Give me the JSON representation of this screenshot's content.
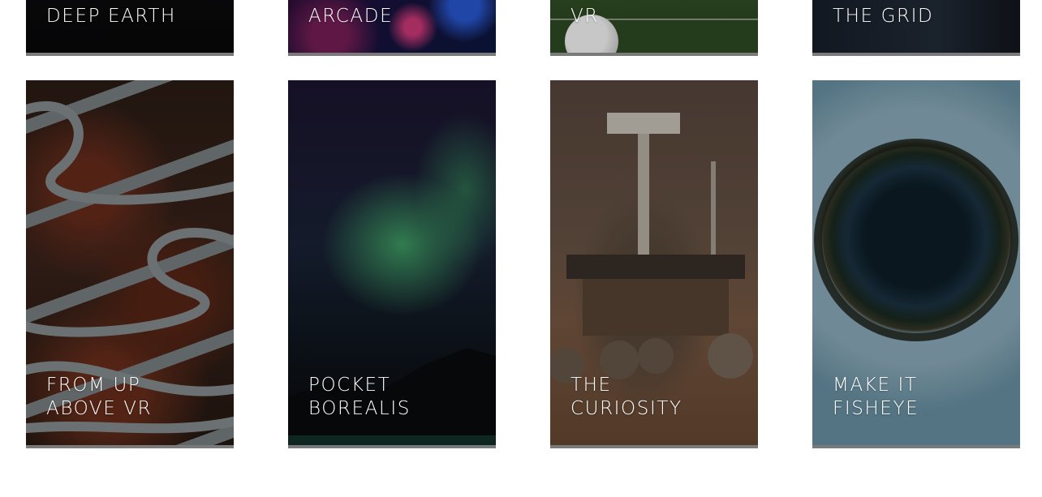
{
  "cards_row1": [
    {
      "title": "DEEP EARTH"
    },
    {
      "title": "NIGHT\nARCADE"
    },
    {
      "title": "SOCCER TEAM\nVR"
    },
    {
      "title": "THE GRID"
    }
  ],
  "cards_row2": [
    {
      "title": "FROM UP\nABOVE VR"
    },
    {
      "title": "POCKET\nBOREALIS"
    },
    {
      "title": "THE\nCURIOSITY"
    },
    {
      "title": "MAKE IT\nFISHEYE"
    }
  ]
}
